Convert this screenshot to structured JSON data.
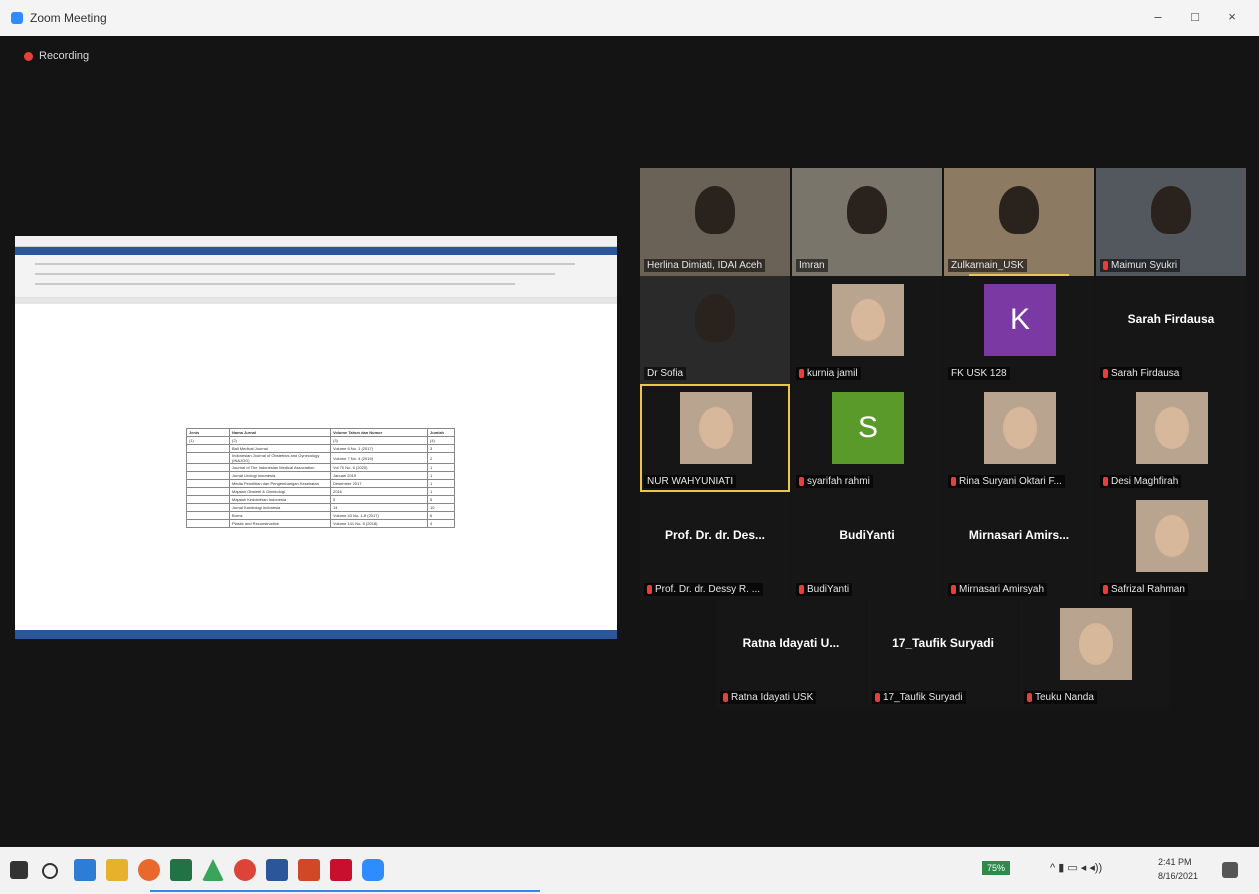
{
  "window": {
    "title": "Zoom Meeting",
    "minimize": "–",
    "maximize": "□",
    "close": "×"
  },
  "recording": {
    "label": "Recording"
  },
  "shared_doc": {
    "table_rows": [
      [
        "Jenis",
        "Nama Jurnal",
        "Volume Tahun dan Nomor",
        "Jumlah"
      ],
      [
        "(1)",
        "(2)",
        "(3)",
        "(4)"
      ],
      [
        "",
        "Bali Medical Journal",
        "Volume 6 No. 1 (2017)",
        "3"
      ],
      [
        "",
        "Indonesian Journal of Obstetrics and Gynecology (INAJOG)",
        "Volume 7 No. 4 (2019)",
        "2"
      ],
      [
        "",
        "Journal of The Indonesian Medical Association",
        "Vol 70 No. 6 (2020)",
        "1"
      ],
      [
        "",
        "Jurnal Urologi Indonesia",
        "Januari 2019",
        "1"
      ],
      [
        "",
        "Media Penelitian dan Pengembangan Kesehatan",
        "Desember 2017",
        "1"
      ],
      [
        "",
        "Majalah Obstetri & Ginekologi",
        "2016",
        "1"
      ],
      [
        "",
        "Majalah Kedokteran Indonesia",
        "5",
        "5"
      ],
      [
        "",
        "Jurnal Kardiologi Indonesia",
        "14",
        "10"
      ],
      [
        "",
        "Burns",
        "Volume 43 No. 1-8 (2017)",
        "6"
      ],
      [
        "",
        "Plastic and Reconstructive",
        "Volume 141 No. 6 (2018)",
        "4"
      ]
    ]
  },
  "participants": [
    {
      "name": "Herlina Dimiati, IDAI Aceh",
      "type": "video",
      "muted": false
    },
    {
      "name": "Imran",
      "type": "video",
      "muted": false
    },
    {
      "name": "Zulkarnain_USK",
      "type": "video",
      "muted": false,
      "speaking": true
    },
    {
      "name": "Maimun Syukri",
      "type": "video",
      "muted": true
    },
    {
      "name": "Dr Sofia",
      "type": "video",
      "muted": false
    },
    {
      "name": "kurnia jamil",
      "type": "photo",
      "muted": true
    },
    {
      "name": "FK USK 128",
      "type": "initial",
      "initial": "K",
      "color": "#7b3aa3",
      "muted": false
    },
    {
      "name": "Sarah Firdausa",
      "display": "Sarah Firdausa",
      "type": "name",
      "muted": true
    },
    {
      "name": "NUR WAHYUNIATI",
      "type": "photo",
      "muted": false,
      "active": true
    },
    {
      "name": "syarifah rahmi",
      "type": "initial",
      "initial": "S",
      "color": "#5a9a2a",
      "muted": true
    },
    {
      "name": "Rina Suryani Oktari F...",
      "type": "photo",
      "muted": true
    },
    {
      "name": "Desi Maghfirah",
      "type": "photo",
      "muted": true
    },
    {
      "name": "Prof. Dr. dr. Dessy R. ...",
      "display": "Prof. Dr. dr. Des...",
      "type": "name",
      "muted": true
    },
    {
      "name": "BudiYanti",
      "display": "BudiYanti",
      "type": "name",
      "muted": true
    },
    {
      "name": "Mirnasari Amirsyah",
      "display": "Mirnasari Amirs...",
      "type": "name",
      "muted": true
    },
    {
      "name": "Safrizal Rahman",
      "type": "photo",
      "muted": true
    },
    {
      "name": "Ratna Idayati USK",
      "display": "Ratna Idayati U...",
      "type": "name",
      "muted": true
    },
    {
      "name": "17_Taufik Suryadi",
      "display": "17_Taufik Suryadi",
      "type": "name",
      "muted": true
    },
    {
      "name": "Teuku Nanda",
      "type": "photo",
      "muted": true
    }
  ],
  "taskbar": {
    "battery": "75%",
    "time": "2:41 PM",
    "date": "8/16/2021"
  },
  "colors": {
    "accent": "#2d8cff",
    "muted": "#e5403a",
    "active_speaker": "#e9c74a"
  }
}
